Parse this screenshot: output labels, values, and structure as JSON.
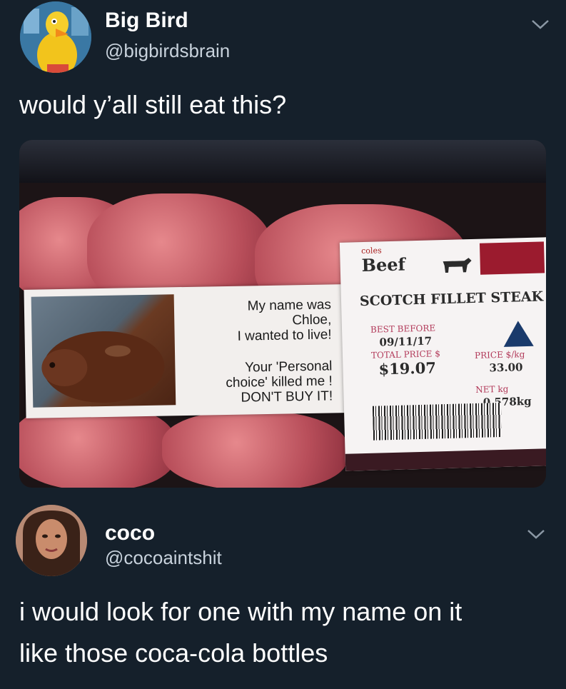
{
  "tweets": [
    {
      "name": "Big Bird",
      "handle": "@bigbirdsbrain",
      "text": "would y’all still eat this?"
    },
    {
      "name": "coco",
      "handle": "@cocoaintshit",
      "text_lines": [
        "i would look for one with my name on it",
        "like those coca-cola bottles"
      ]
    }
  ],
  "photo": {
    "left_label": {
      "top_lines": [
        "My name was",
        "Chloe,",
        "I wanted to live!"
      ],
      "bottom_lines": [
        "Your 'Personal",
        "choice' killed me !",
        "DON'T BUY IT!"
      ]
    },
    "right_label": {
      "brand": "coles",
      "product_category": "Beef",
      "product": "SCOTCH FILLET STEAK",
      "best_before_label": "BEST BEFORE",
      "best_before": "09/11/17",
      "total_price_label": "TOTAL PRICE $",
      "total_price": "$19.07",
      "price_per_kg_label": "PRICE $/kg",
      "price_per_kg": "33.00",
      "net_label": "NET kg",
      "net_weight": "0.578kg"
    }
  },
  "colors": {
    "background": "#15202b",
    "text": "#ffffff",
    "secondary_text": "#c8d2dc"
  },
  "icons": [
    "chevron-down-icon"
  ]
}
